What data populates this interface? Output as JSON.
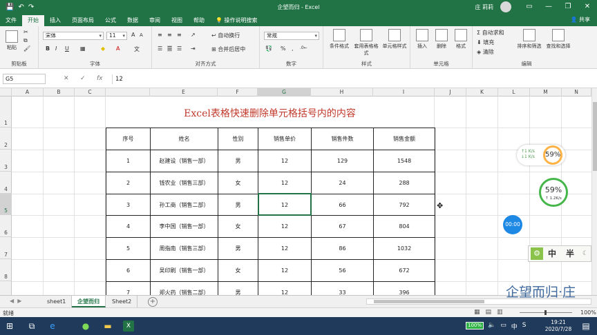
{
  "window": {
    "title": "企望而归 - Excel",
    "user": "庄 莉莉",
    "qa_save_icon": "save-icon",
    "qa_undo_icon": "undo-icon",
    "qa_redo_icon": "redo-icon"
  },
  "menu": {
    "tabs": [
      "文件",
      "开始",
      "插入",
      "页面布局",
      "公式",
      "数据",
      "审阅",
      "视图",
      "帮助"
    ],
    "active_index": 1,
    "tell_me": "操作说明搜索",
    "share": "共享"
  },
  "ribbon": {
    "clipboard": {
      "label": "剪贴板",
      "paste": "粘贴"
    },
    "font": {
      "label": "字体",
      "name": "宋体",
      "size": "11",
      "bold": "B",
      "italic": "I",
      "underline": "U"
    },
    "alignment": {
      "label": "对齐方式",
      "wrap": "自动换行",
      "merge": "合并后居中"
    },
    "number": {
      "label": "数字",
      "format": "常规",
      "percent": "%",
      "comma": ","
    },
    "styles": {
      "label": "样式",
      "conditional": "条件格式",
      "table_fmt": "套用表格格式",
      "cell_style": "单元格样式"
    },
    "cells": {
      "label": "单元格",
      "insert": "插入",
      "delete": "删除",
      "format": "格式"
    },
    "editing": {
      "label": "编辑",
      "autosum": "自动求和",
      "fill": "填充",
      "clear": "清除",
      "sort": "排序和筛选",
      "find": "查找和选择"
    }
  },
  "formula_bar": {
    "name_box": "G5",
    "fx": "fx",
    "value": "12"
  },
  "grid": {
    "columns": [
      "A",
      "B",
      "C",
      "E",
      "F",
      "G",
      "H",
      "I",
      "J",
      "K",
      "L",
      "M",
      "N"
    ],
    "selected_column": "G",
    "rows": [
      "1",
      "2",
      "3",
      "4",
      "5",
      "6",
      "7",
      "8"
    ],
    "selected_row": "5"
  },
  "sheet_title": "Excel表格快速删除单元格括号内的内容",
  "table": {
    "headers": [
      "序号",
      "姓名",
      "性别",
      "销售单价",
      "销售件数",
      "销售金额"
    ],
    "rows": [
      [
        "1",
        "赵建设（销售一部）",
        "男",
        "12",
        "129",
        "1548"
      ],
      [
        "2",
        "钱农业（销售三部）",
        "女",
        "12",
        "24",
        "288"
      ],
      [
        "3",
        "孙工商（销售二部）",
        "男",
        "12",
        "66",
        "792"
      ],
      [
        "4",
        "李中国（销售一部）",
        "女",
        "12",
        "67",
        "804"
      ],
      [
        "5",
        "周指南（销售三部）",
        "男",
        "12",
        "86",
        "1032"
      ],
      [
        "6",
        "吴印刷（销售一部）",
        "女",
        "12",
        "56",
        "672"
      ],
      [
        "7",
        "郑火药（销售二部）",
        "男",
        "12",
        "33",
        "396"
      ]
    ]
  },
  "sheet_tabs": {
    "tabs": [
      "sheet1",
      "企望而归",
      "Sheet2"
    ],
    "active_index": 1,
    "add": "+"
  },
  "status": {
    "ready": "就绪",
    "zoom": "100%"
  },
  "taskbar": {
    "battery": "100%",
    "ime_lang": "中",
    "ime_sym": "S",
    "time": "19:21",
    "date": "2020/7/28"
  },
  "overlays": {
    "net_up": "↑1 K/s",
    "net_down": "↓1 K/s",
    "cpu1": "59%",
    "cpu2": "59%",
    "speed2": "↑ 1.2K/s",
    "timer": "00:00",
    "ime_cn": "中",
    "ime_half": "半",
    "watermark": "企望而归·庄"
  },
  "colors": {
    "excel_green": "#217346",
    "title_red": "#c0392b",
    "taskbar": "#1f3a5a"
  }
}
